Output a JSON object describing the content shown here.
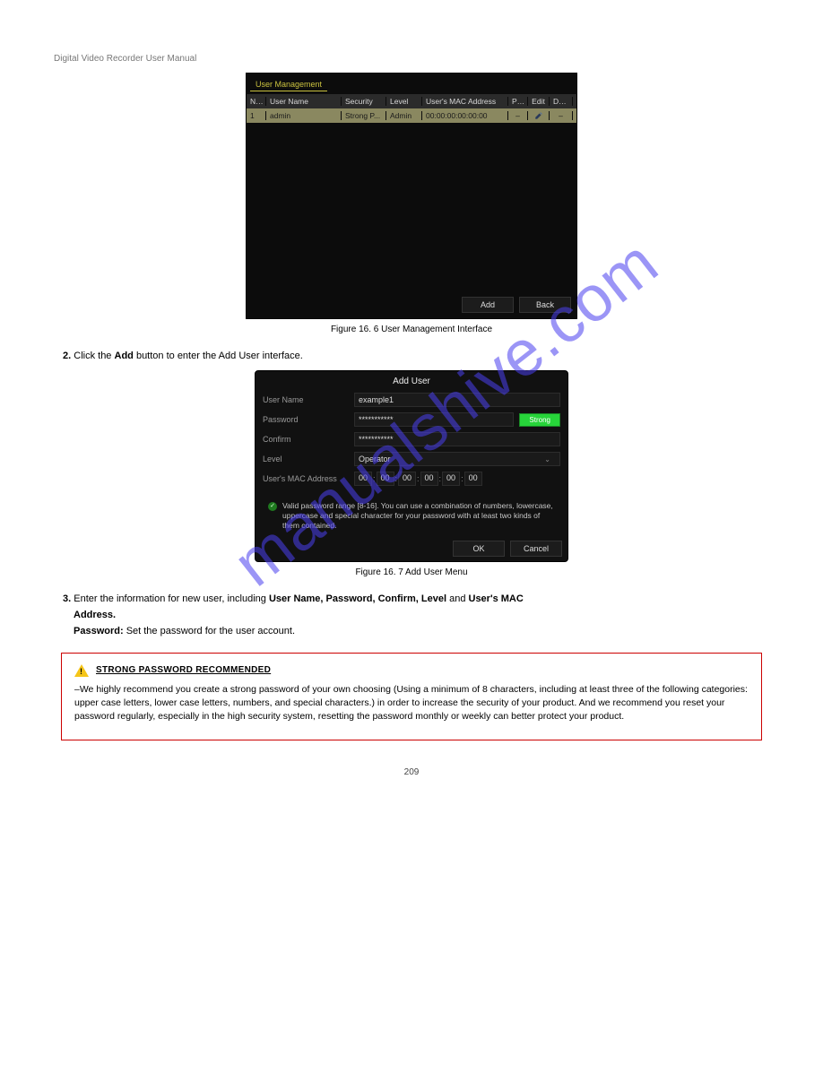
{
  "header": {
    "doc_title": "Digital Video Recorder User Manual"
  },
  "watermark": "manualshive.com",
  "panel1": {
    "title": "User Management",
    "columns": {
      "no": "No.",
      "user": "User Name",
      "security": "Security",
      "level": "Level",
      "mac": "User's MAC Address",
      "pe": "Pe...",
      "edit": "Edit",
      "del": "Del..."
    },
    "row": {
      "no": "1",
      "user": "admin",
      "security": "Strong P...",
      "level": "Admin",
      "mac": "00:00:00:00:00:00",
      "pe": "–",
      "del": "–"
    },
    "buttons": {
      "add": "Add",
      "back": "Back"
    }
  },
  "caption1": "Figure 16. 6 User Management Interface",
  "step2": {
    "label": "2.",
    "text": "Click the Add button to enter the Add User interface."
  },
  "panel2": {
    "title": "Add User",
    "labels": {
      "username": "User Name",
      "password": "Password",
      "confirm": "Confirm",
      "level": "Level",
      "mac": "User's MAC Address"
    },
    "values": {
      "username": "example1",
      "password": "***********",
      "confirm": "***********",
      "level": "Operator",
      "mac": [
        "00",
        "00",
        "00",
        "00",
        "00",
        "00"
      ]
    },
    "strength": "Strong",
    "hint": "Valid password range [8-16]. You can use a combination of numbers, lowercase, uppercase and special character for your password with at least two kinds of them contained.",
    "buttons": {
      "ok": "OK",
      "cancel": "Cancel"
    }
  },
  "caption2": "Figure 16. 7 Add User Menu",
  "step3": {
    "label": "3.",
    "line1_a": "Enter the information for new user, including ",
    "line1_b": "User Name, Password, Confirm, Level ",
    "line1_c": "and ",
    "line1_d": "User's MAC",
    "line2": "Address.",
    "pw_label": "Password: ",
    "pw_text": "Set the password for the user account."
  },
  "warn": {
    "title": "STRONG PASSWORD RECOMMENDED",
    "text": "–We highly recommend you create a strong password of your own choosing (Using a minimum of 8 characters, including at least three of the following categories: upper case letters, lower case letters, numbers, and special characters.) in order to increase the security of your product. And we recommend you reset your password regularly, especially in the high security system, resetting the password monthly or weekly can better protect your product."
  },
  "pagenum": "209"
}
